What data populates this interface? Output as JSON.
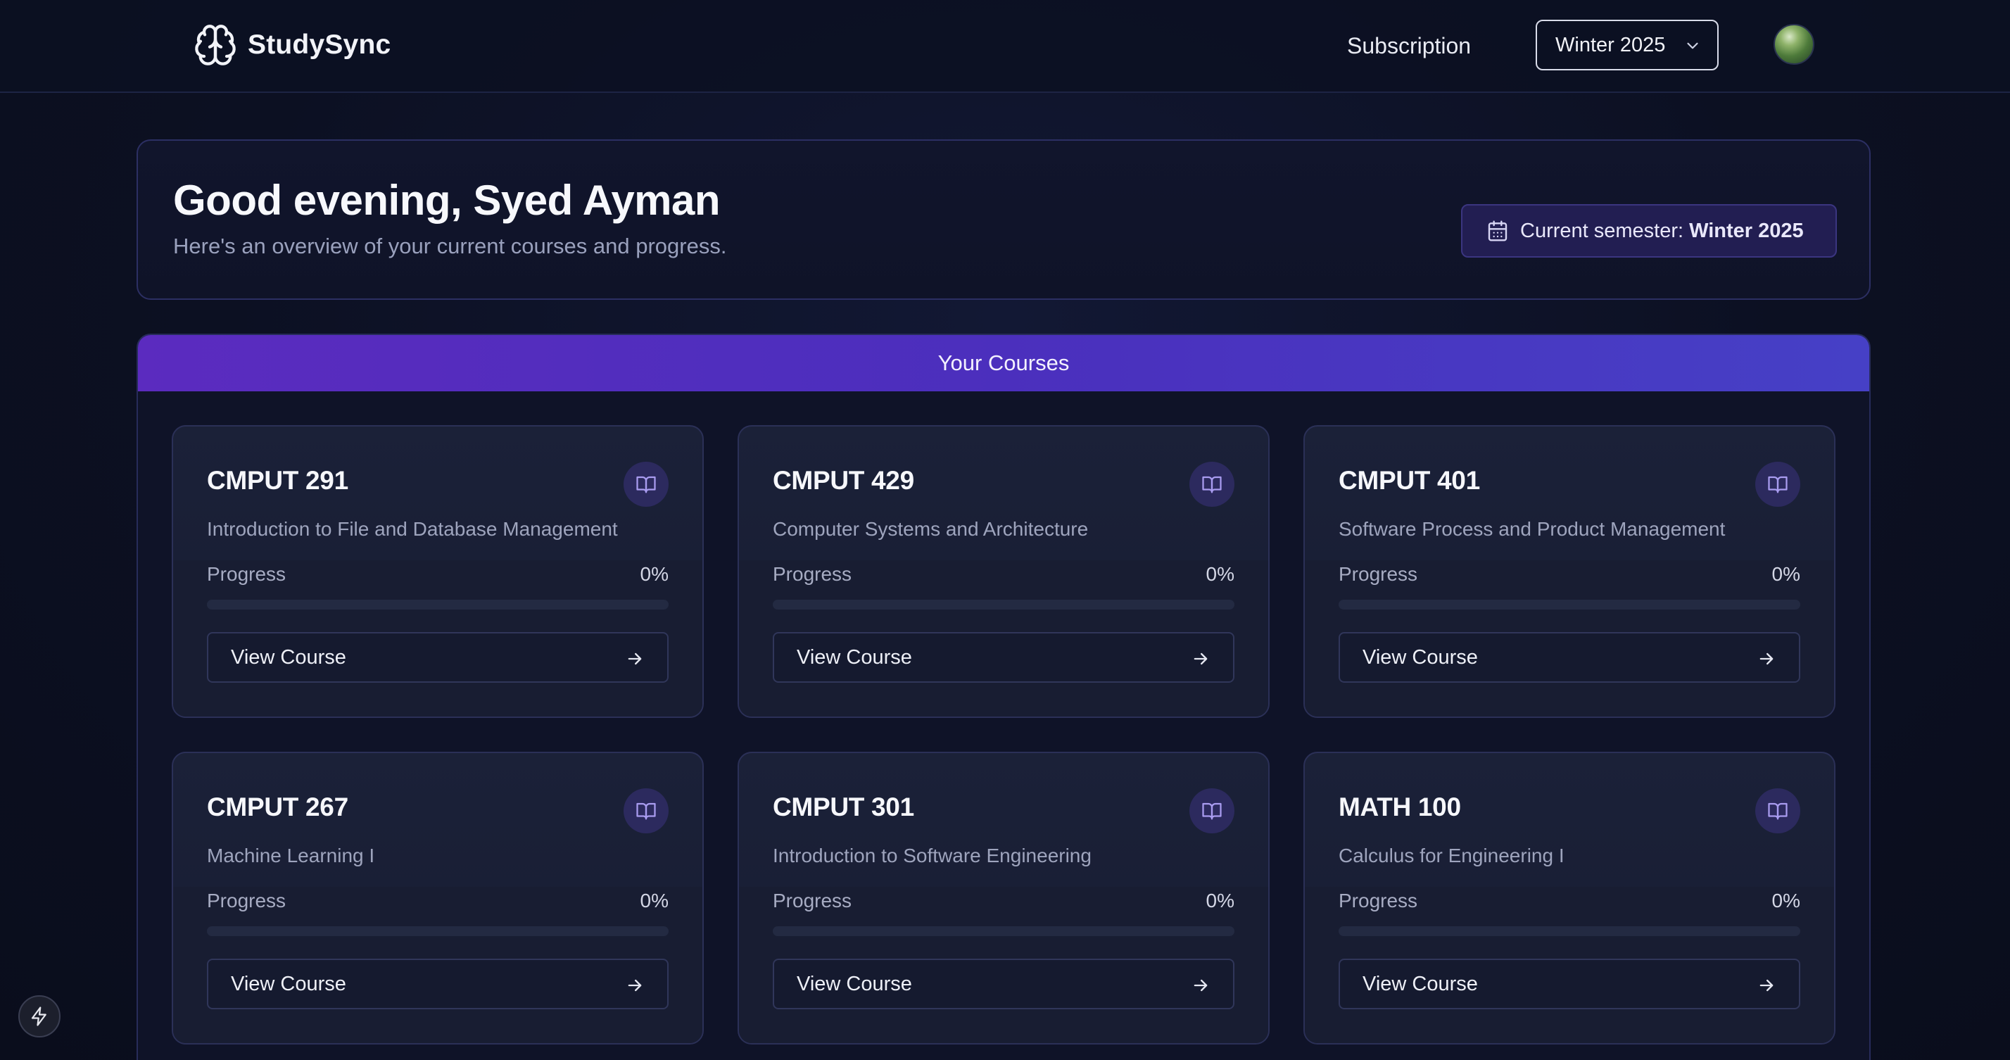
{
  "header": {
    "brand": "StudySync",
    "nav_subscription": "Subscription",
    "semester_select": "Winter 2025"
  },
  "greeting": {
    "title": "Good evening, Syed Ayman",
    "subtitle": "Here's an overview of your current courses and progress.",
    "badge_label": "Current semester:",
    "badge_value": "Winter 2025"
  },
  "courses": {
    "heading": "Your Courses",
    "progress_label": "Progress",
    "view_label": "View Course",
    "items": [
      {
        "code": "CMPUT 291",
        "name": "Introduction to File and Database Management",
        "progress_text": "0%",
        "progress": 0
      },
      {
        "code": "CMPUT 429",
        "name": "Computer Systems and Architecture",
        "progress_text": "0%",
        "progress": 0
      },
      {
        "code": "CMPUT 401",
        "name": "Software Process and Product Management",
        "progress_text": "0%",
        "progress": 0
      },
      {
        "code": "CMPUT 267",
        "name": "Machine Learning I",
        "progress_text": "0%",
        "progress": 0
      },
      {
        "code": "CMPUT 301",
        "name": "Introduction to Software Engineering",
        "progress_text": "0%",
        "progress": 0
      },
      {
        "code": "MATH 100",
        "name": "Calculus for Engineering I",
        "progress_text": "0%",
        "progress": 0
      }
    ]
  },
  "colors": {
    "accent": "#5b2bbf",
    "accent_end": "#4640c6",
    "badge_bg": "#221e52",
    "background": "#0d1124"
  },
  "icons": {
    "brand": "brain-icon",
    "select": "chevron-down-icon",
    "badge": "calendar-icon",
    "course": "book-open-icon",
    "view": "arrow-right-icon",
    "floating": "bolt-icon"
  }
}
